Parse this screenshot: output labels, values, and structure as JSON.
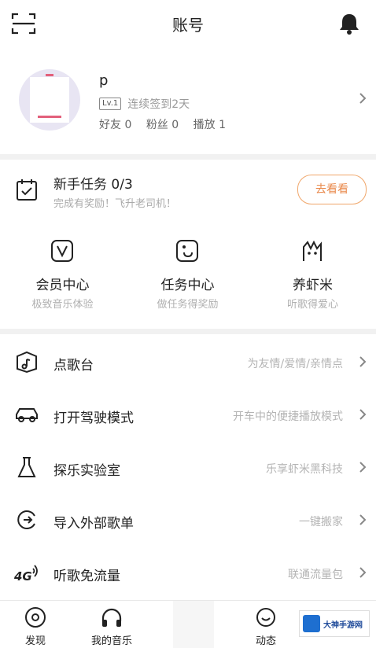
{
  "header": {
    "title": "账号"
  },
  "profile": {
    "username": "p",
    "level": "Lv.1",
    "streak": "连续签到2天",
    "stats": [
      "好友 0",
      "粉丝 0",
      "播放 1"
    ]
  },
  "task": {
    "title": "新手任务 0/3",
    "subtitle": "完成有奖励！飞升老司机！",
    "button": "去看看"
  },
  "grid": [
    {
      "label": "会员中心",
      "sub": "极致音乐体验"
    },
    {
      "label": "任务中心",
      "sub": "做任务得奖励"
    },
    {
      "label": "养虾米",
      "sub": "听歌得爱心"
    }
  ],
  "menu": [
    {
      "label": "点歌台",
      "sub": "为友情/爱情/亲情点"
    },
    {
      "label": "打开驾驶模式",
      "sub": "开车中的便捷播放模式"
    },
    {
      "label": "探乐实验室",
      "sub": "乐享虾米黑科技"
    },
    {
      "label": "导入外部歌单",
      "sub": "一键搬家"
    },
    {
      "label": "听歌免流量",
      "sub": "联通流量包"
    }
  ],
  "tabs": [
    {
      "label": "发现"
    },
    {
      "label": "我的音乐"
    },
    {
      "label": "动态"
    }
  ],
  "watermark": "大神手游网"
}
